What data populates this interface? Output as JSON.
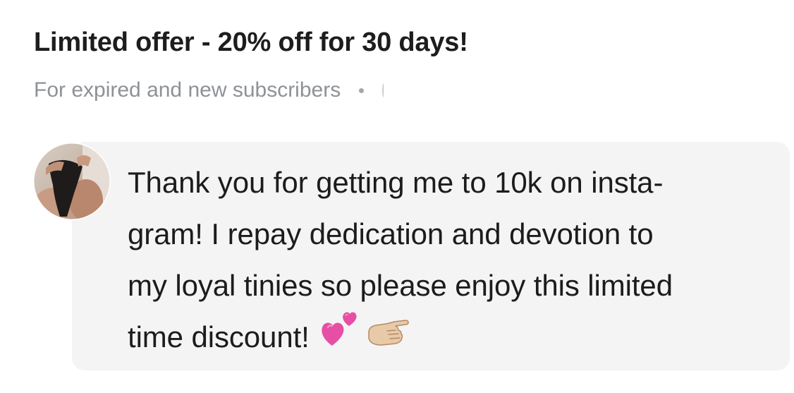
{
  "offer": {
    "title": "Limited offer - 20% off for 30 days!",
    "subtitle": "For expired and new subscribers"
  },
  "message": {
    "line1": "Thank you for getting me to 10k on insta-",
    "line2": "gram! I repay dedication and devotion to",
    "line3": "my loyal tinies so please enjoy this limited",
    "line4": "time discount!",
    "emojis": [
      "two-hearts-icon",
      "pointing-hand-icon"
    ]
  },
  "colors": {
    "title": "#1d1d1d",
    "subtitle": "#8e9296",
    "card_background": "#f4f4f5",
    "heart": "#e64fa4"
  }
}
